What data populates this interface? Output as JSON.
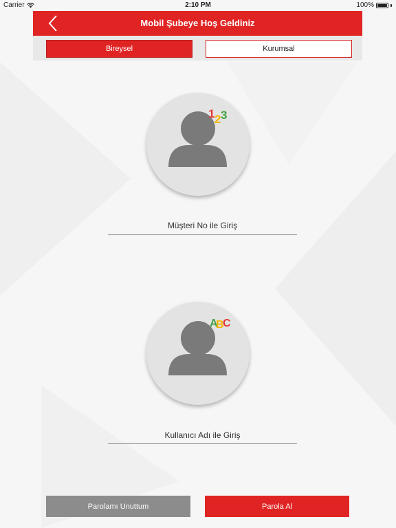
{
  "status_bar": {
    "carrier": "Carrier",
    "time": "2:10 PM",
    "battery": "100%"
  },
  "header": {
    "title": "Mobil Şubeye Hoş Geldiniz",
    "back_icon": "chevron-left-icon"
  },
  "tabs": [
    {
      "label": "Bireysel",
      "selected": true
    },
    {
      "label": "Kurumsal",
      "selected": false
    }
  ],
  "login_options": [
    {
      "label": "Müşteri No ile Giriş",
      "badge": [
        "1",
        "2",
        "3"
      ],
      "icon": "user-123-icon"
    },
    {
      "label": "Kullanıcı Adı ile Giriş",
      "badge": [
        "A",
        "B",
        "C"
      ],
      "icon": "user-abc-icon"
    }
  ],
  "buttons": {
    "forgot_password": "Parolamı Unuttum",
    "get_password": "Parola Al"
  },
  "colors": {
    "brand_red": "#e02424",
    "gray_button": "#8c8c8c",
    "avatar_gray": "#7a7a7a",
    "badge_red": "#e53935",
    "badge_yellow": "#f4b400",
    "badge_green": "#43a047"
  }
}
